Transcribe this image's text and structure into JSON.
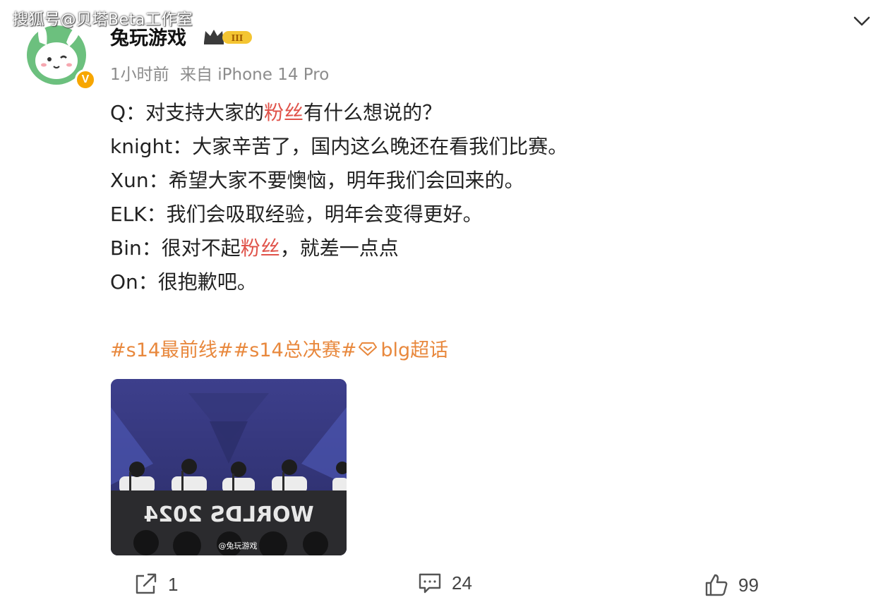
{
  "watermark": "搜狐号@贝塔Beta工作室",
  "post": {
    "author": "兔玩游戏",
    "level_badge": "III",
    "verified_mark": "V",
    "time": "1小时前",
    "source": "来自 iPhone 14 Pro",
    "lines": [
      {
        "pre": "Q：对支持大家的",
        "hl": "粉丝",
        "post": "有什么想说的？"
      },
      {
        "pre": "knight：大家辛苦了，国内这么晚还在看我们比赛。",
        "hl": "",
        "post": ""
      },
      {
        "pre": "Xun：希望大家不要懊恼，明年我们会回来的。",
        "hl": "",
        "post": ""
      },
      {
        "pre": "ELK：我们会吸取经验，明年会变得更好。",
        "hl": "",
        "post": ""
      },
      {
        "pre": "Bin：很对不起",
        "hl": "粉丝",
        "post": "，就差一点点"
      },
      {
        "pre": "On：很抱歉吧。",
        "hl": "",
        "post": ""
      }
    ],
    "tags": {
      "tag1": "#s14最前线#",
      "tag2": "#s14总决赛#",
      "tag3": "blg超话"
    },
    "media": {
      "banner_text": "WORLDS 2024",
      "caption": "@兔玩游戏"
    }
  },
  "actions": {
    "forward_count": "1",
    "comment_count": "24",
    "like_count": "99"
  },
  "colors": {
    "highlight": "#e0534a",
    "tag": "#e8883d",
    "meta": "#8c8c8c",
    "verified": "#f7a600"
  },
  "icons": [
    "chevron-down-icon",
    "crown-icon",
    "forward-icon",
    "comment-icon",
    "like-icon",
    "super-topic-icon"
  ]
}
